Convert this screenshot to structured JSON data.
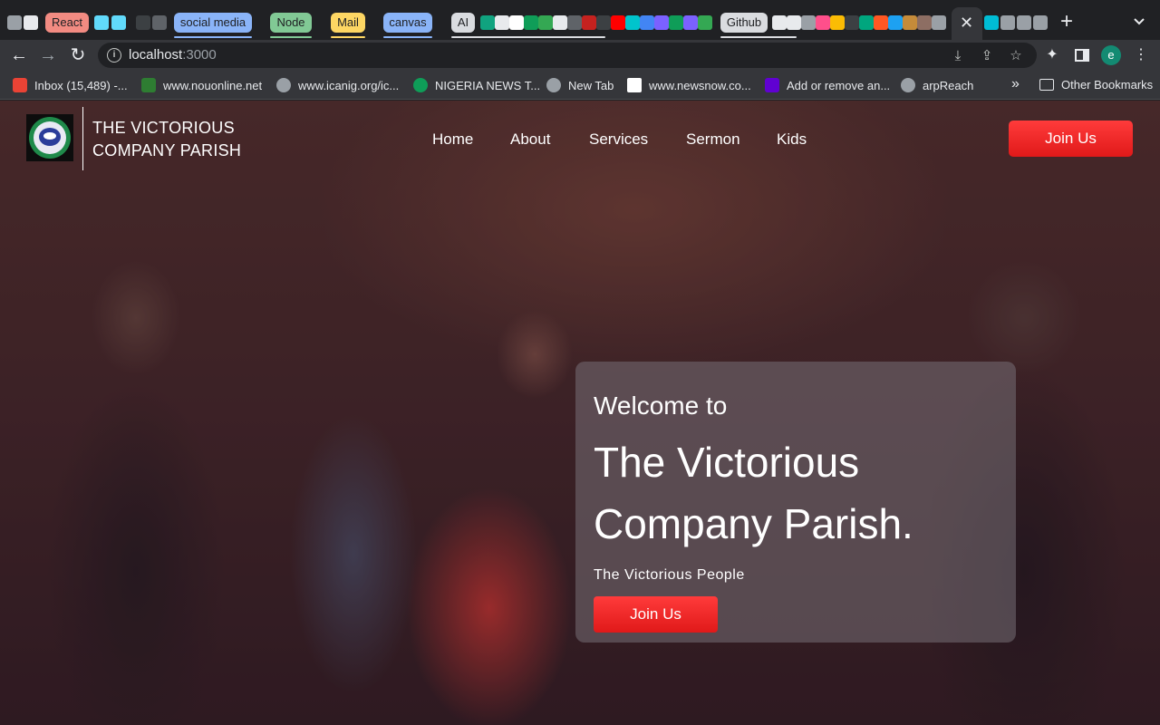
{
  "browser": {
    "tab_groups": [
      {
        "label": "React",
        "color": "#f28b82"
      },
      {
        "label": "social media",
        "color": "#8ab4f8"
      },
      {
        "label": "Node",
        "color": "#81c995"
      },
      {
        "label": "Mail",
        "color": "#fdd663"
      },
      {
        "label": "canvas",
        "color": "#8ab4f8"
      },
      {
        "label": "AI",
        "color": "#dadce0"
      },
      {
        "label": "Github",
        "color": "#dadce0"
      }
    ],
    "close_tab_glyph": "✕",
    "new_tab_glyph": "+",
    "address": {
      "host": "localhost",
      "port": ":3000"
    },
    "bookmarks": [
      {
        "label": "Inbox (15,489) -...",
        "icon": "gmail-icon",
        "color": "#ea4335"
      },
      {
        "label": "www.nouonline.net",
        "icon": "noun-icon",
        "color": "#2e7d32"
      },
      {
        "label": "www.icanig.org/ic...",
        "icon": "globe-icon",
        "color": "#9aa0a6"
      },
      {
        "label": "NIGERIA NEWS T...",
        "icon": "nigeria-news-icon",
        "color": "#0f9d58"
      },
      {
        "label": "New Tab",
        "icon": "globe-icon",
        "color": "#9aa0a6"
      },
      {
        "label": "www.newsnow.co...",
        "icon": "newsnow-icon",
        "color": "#ffffff"
      },
      {
        "label": "Add or remove an...",
        "icon": "yahoo-icon",
        "color": "#6001d2"
      },
      {
        "label": "arpReach",
        "icon": "globe-icon",
        "color": "#9aa0a6"
      }
    ],
    "more_bookmarks_glyph": "»",
    "other_bookmarks": "Other Bookmarks",
    "profile_initial": "e"
  },
  "site": {
    "brand": {
      "line1": "THE VICTORIOUS",
      "line2": "COMPANY PARISH"
    },
    "nav": [
      "Home",
      "About",
      "Services",
      "Sermon",
      "Kids"
    ],
    "join_label": "Join Us",
    "accent": "#ff2a2a"
  },
  "hero": {
    "welcome": "Welcome to",
    "title_line1": "The Victorious",
    "title_line2": "Company Parish.",
    "tagline": "The Victorious People",
    "cta": "Join Us"
  }
}
